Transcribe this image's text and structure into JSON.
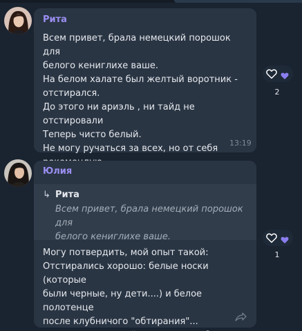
{
  "messages": [
    {
      "sender": "Рита",
      "text": "Всем привет, брала немецкий порошок для\nбелого кениглихе ваше.\nНа белом халате был желтый воротник -\nотстирался.\nДо этого ни ариэль , ни тайд не отстировали\nТеперь чисто белый.\nНе могу ручаться за всех, но от себя\nрекомендую",
      "time": "13:19",
      "reactions": {
        "heart_icon": "heart-outline-icon",
        "liked_icon": "heart-filled-icon",
        "count": "2"
      }
    },
    {
      "sender": "Юлия",
      "reply": {
        "name": "Рита",
        "text": "Всем привет, брала немецкий порошок для\nбелого кениглихе ваше."
      },
      "text": "Могу потвердить, мой опыт такой:\nОтстирались хорошо: белые носки (которые\nбыли черные, ну дети....) и белое полотенце\nпосле клубничого \"обтирания\"...\nэто я про немецкий порошок для белого.",
      "reactions": {
        "heart_icon": "heart-outline-icon",
        "liked_icon": "heart-filled-icon",
        "count": "1"
      }
    }
  ],
  "colors": {
    "background": "#1a2330",
    "bubble": "#2a3544",
    "sender": "#9b8ff2",
    "accent_heart": "#8b7ff0"
  }
}
